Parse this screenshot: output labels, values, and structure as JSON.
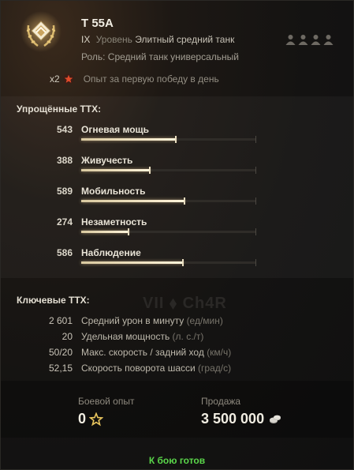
{
  "header": {
    "tank_name": "T 55A",
    "tier": "IX",
    "tier_word": "Уровень",
    "class_name": "Элитный средний танк",
    "role": "Роль: Средний танк универсальный",
    "crew_count": 4
  },
  "first_win_xp": {
    "multiplier": "x2",
    "text": "Опыт за первую победу в день"
  },
  "simplified_stats": {
    "title": "Упрощённые ТТХ:",
    "items": [
      {
        "value": "543",
        "label": "Огневая мощь",
        "fill": 0.54
      },
      {
        "value": "388",
        "label": "Живучесть",
        "fill": 0.39
      },
      {
        "value": "589",
        "label": "Мобильность",
        "fill": 0.59
      },
      {
        "value": "274",
        "label": "Незаметность",
        "fill": 0.27
      },
      {
        "value": "586",
        "label": "Наблюдение",
        "fill": 0.58
      }
    ]
  },
  "key_stats": {
    "title": "Ключевые ТТХ:",
    "items": [
      {
        "value": "2 601",
        "label": "Средний урон в минуту",
        "unit": "(ед/мин)"
      },
      {
        "value": "20",
        "label": "Удельная мощность",
        "unit": "(л. с./т)"
      },
      {
        "value": "50/20",
        "label": "Макс. скорость / задний ход",
        "unit": "(км/ч)"
      },
      {
        "value": "52,15",
        "label": "Скорость поворота шасси",
        "unit": "(град/с)"
      }
    ]
  },
  "watermark": "VII ⬧ Ch4R",
  "footer": {
    "battle_xp_label": "Боевой опыт",
    "battle_xp_value": "0",
    "sale_label": "Продажа",
    "sale_value": "3 500 000"
  },
  "status": "К бою готов",
  "colors": {
    "ready": "#5ad64a",
    "bar_fill": "#fff4da"
  }
}
